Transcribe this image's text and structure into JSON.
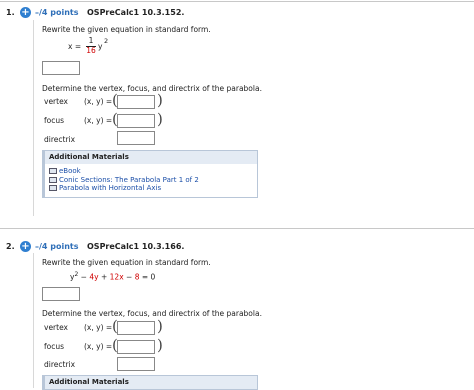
{
  "questions": [
    {
      "number": "1.",
      "points": "–/4 points",
      "id": "OSPreCalc1 10.3.152.",
      "prompt": "Rewrite the given equation in standard form.",
      "equation": {
        "lhs": "x =",
        "num": "1",
        "den": "16",
        "rhs": "y",
        "exp": "2"
      },
      "determine": "Determine the vertex, focus, and directrix of the parabola.",
      "vertex_label": "vertex",
      "focus_label": "focus",
      "directrix_label": "directrix",
      "xy": "(x, y) =",
      "materials": {
        "title": "Additional Materials",
        "items": [
          "eBook",
          "Conic Sections: The Parabola Part 1 of 2",
          "Parabola with Horizontal Axis"
        ]
      }
    },
    {
      "number": "2.",
      "points": "–/4 points",
      "id": "OSPreCalc1 10.3.166.",
      "prompt": "Rewrite the given equation in standard form.",
      "equation": {
        "y": "y",
        "exp": "2",
        "t1": "−",
        "t2": "4y",
        "t3": "+",
        "t4": "12x",
        "t5": "−",
        "t6": "8",
        "t7": "= 0"
      },
      "determine": "Determine the vertex, focus, and directrix of the parabola.",
      "vertex_label": "vertex",
      "focus_label": "focus",
      "directrix_label": "directrix",
      "xy": "(x, y) =",
      "materials": {
        "title": "Additional Materials"
      }
    }
  ],
  "colors": {
    "accent": "#2f7fd0",
    "highlight": "#d00000",
    "link": "#1c4fa8"
  }
}
